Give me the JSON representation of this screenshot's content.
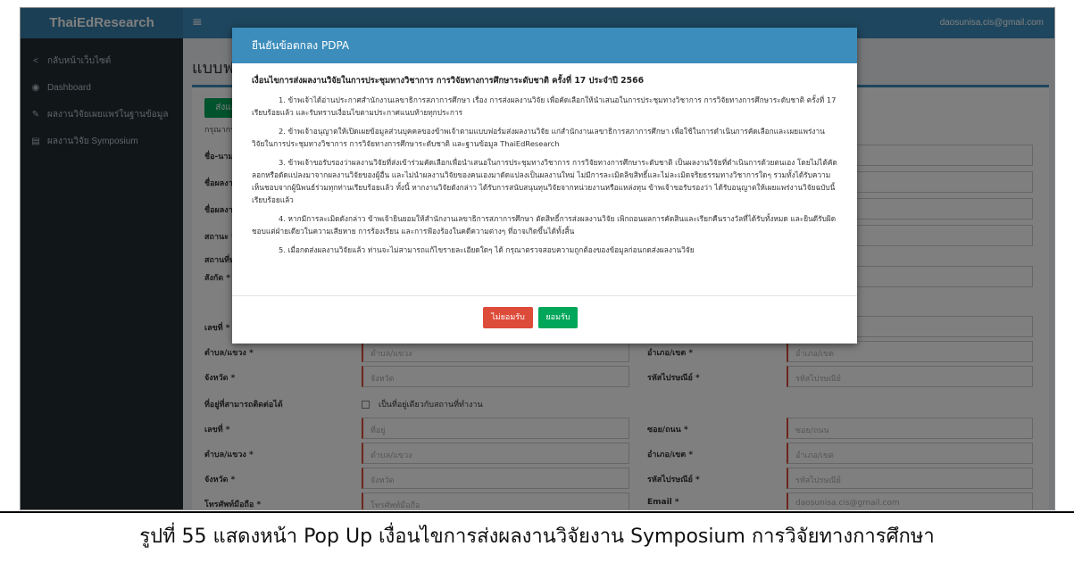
{
  "app": {
    "brand": "ThaiEdResearch",
    "user_email": "daosunisa.cis@gmail.com"
  },
  "sidebar": {
    "items": [
      {
        "icon": "chevron-left-icon",
        "glyph": "<",
        "label": "กลับหน้าเว็บไซต์"
      },
      {
        "icon": "dashboard-icon",
        "glyph": "◉",
        "label": "Dashboard"
      },
      {
        "icon": "wrench-icon",
        "glyph": "✎",
        "label": "ผลงานวิจัยเผยแพร่ในฐานข้อมูล"
      },
      {
        "icon": "document-icon",
        "glyph": "▤",
        "label": "ผลงานวิจัย Symposium"
      }
    ]
  },
  "page": {
    "title": "แบบฟ",
    "save_label": "ส่งแก้",
    "hint": "กรุณากรอ"
  },
  "form": {
    "rows": [
      {
        "label": "ชื่อ-นามส",
        "type": "wide",
        "value": ""
      },
      {
        "label": "ชื่อผลงา",
        "type": "wide",
        "value": ""
      },
      {
        "label": "ชื่อผลงา",
        "type": "wide",
        "value": ""
      },
      {
        "label": "สถานะ *",
        "type": "wide",
        "value": ""
      },
      {
        "label": "สถานที่ท",
        "type": "wide",
        "value": ""
      },
      {
        "label": "สังกัด *",
        "type": "wide",
        "value": ""
      }
    ],
    "address_work": {
      "no_label": "เลขที่ *",
      "subdistrict_label": "ตำบล/แขวง *",
      "subdistrict_placeholder": "ตำบล/แขวง",
      "district_label": "อำเภอ/เขต *",
      "district_placeholder": "อำเภอ/เขต",
      "province_label": "จังหวัด *",
      "province_placeholder": "จังหวัด",
      "postcode_label": "รหัสไปรษณีย์ *",
      "postcode_placeholder": "รหัสไปรษณีย์"
    },
    "contact_label": "ที่อยู่ที่สามารถติดต่อได้",
    "same_address_label": "เป็นที่อยู่เดียวกับสถานที่ทำงาน",
    "address_contact": {
      "no_label": "เลขที่ *",
      "no_placeholder": "ที่อยู่",
      "road_label": "ซอย/ถนน *",
      "road_placeholder": "ซอย/ถนน",
      "subdistrict_label": "ตำบล/แขวง *",
      "subdistrict_placeholder": "ตำบล/แขวง",
      "district_label": "อำเภอ/เขต *",
      "district_placeholder": "อำเภอ/เขต",
      "province_label": "จังหวัด *",
      "province_placeholder": "จังหวัด",
      "postcode_label": "รหัสไปรษณีย์ *",
      "postcode_placeholder": "รหัสไปรษณีย์"
    },
    "phone_label": "โทรศัพท์มือถือ *",
    "phone_placeholder": "โทรศัพท์มือถือ",
    "email_label": "Email *",
    "email_value": "daosunisa.cis@gmail.com"
  },
  "modal": {
    "title": "ยืนยันข้อตกลง PDPA",
    "heading": "เงื่อนไขการส่งผลงานวิจัยในการประชุมทางวิชาการ การวิจัยทางการศึกษาระดับชาติ ครั้งที่ 17 ประจำปี 2566",
    "clauses": [
      "1. ข้าพเจ้าได้อ่านประกาศสำนักงานเลขาธิการสภาการศึกษา เรื่อง การส่งผลงานวิจัย เพื่อคัดเลือกให้นำเสนอในการประชุมทางวิชาการ การวิจัยทางการศึกษาระดับชาติ ครั้งที่ 17 เรียบร้อยแล้ว และรับทราบเงื่อนไขตามประกาศแนบท้ายทุกประการ",
      "2. ข้าพเจ้าอนุญาตให้เปิดเผยข้อมูลส่วนบุคคลของข้าพเจ้าตามแบบฟอร์มส่งผลงานวิจัย แก่สำนักงานเลขาธิการสภาการศึกษา เพื่อใช้ในการดำเนินการคัดเลือกและเผยแพร่งานวิจัยในการประชุมทางวิชาการ การวิจัยทางการศึกษาระดับชาติ และฐานข้อมูล ThaiEdResearch",
      "3. ข้าพเจ้าขอรับรองว่าผลงานวิจัยที่ส่งเข้าร่วมคัดเลือกเพื่อนำเสนอในการประชุมทางวิชาการ การวิจัยทางการศึกษาระดับชาติ เป็นผลงานวิจัยที่ดำเนินการด้วยตนเอง โดยไม่ได้คัดลอกหรือดัดแปลงมาจากผลงานวิจัยของผู้อื่น และไม่นำผลงานวิจัยของคนเองมาดัดแปลงเป็นผลงานใหม่ ไม่มีการละเมิดลิขสิทธิ์และไม่ละเมิดจริยธรรมทางวิชาการใดๆ รวมทั้งได้รับความเห็นชอบจากผู้นิพนธ์ร่วมทุกท่านเรียบร้อยแล้ว ทั้งนี้ หากงานวิจัยดังกล่าว ได้รับการสนับสนุนทุนวิจัยจากหน่วยงานหรือแหล่งทุน ข้าพเจ้าขอรับรองว่า ได้รับอนุญาตให้เผยแพร่งานวิจัยฉบับนี้เรียบร้อยแล้ว",
      "4. หากมีการละเมิดดังกล่าว ข้าพเจ้ายินยอมให้สำนักงานเลขาธิการสภาการศึกษา ตัดสิทธิ์การส่งผลงานวิจัย เพิกถอนผลการคัดสินและเรียกคืนรางวัลที่ได้รับทั้งหมด และยินดีรับผิดชอบแต่ฝ่ายเดียวในความเสียหาย การร้องเรียน และการฟ้องร้องในคดีความต่างๆ ที่อาจเกิดขึ้นได้ทั้งสิ้น",
      "5. เมื่อกดส่งผลงานวิจัยแล้ว ท่านจะไม่สามารถแก้ไขรายละเอียดใดๆ ได้ กรุณาตรวจสอบความถูกต้องของข้อมูลก่อนกดส่งผลงานวิจัย"
    ],
    "decline_label": "ไม่ยอมรับ",
    "accept_label": "ยอมรับ"
  },
  "caption": "รูปที่ 55 แสดงหน้า Pop Up เงื่อนไขการส่งผลงานวิจัยงาน Symposium การวิจัยทางการศึกษา",
  "colors": {
    "primary": "#3c8dbc",
    "sidebar_bg": "#222d32",
    "success": "#00a65a",
    "danger": "#dd4b39"
  }
}
